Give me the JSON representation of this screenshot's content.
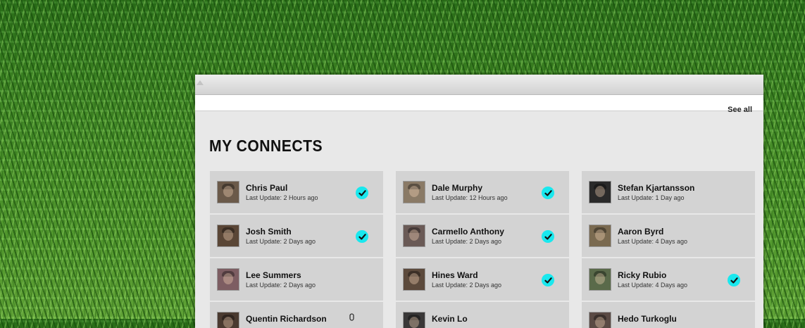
{
  "page": {
    "see_all": "See all",
    "section_title": "MY CONNECTS"
  },
  "connects": [
    {
      "name": "Chris Paul",
      "update": "Last Update: 2 Hours ago",
      "checked": true,
      "avatar_color": "#6b5a4a"
    },
    {
      "name": "Josh Smith",
      "update": "Last Update: 2 Days ago",
      "checked": true,
      "avatar_color": "#5a4636"
    },
    {
      "name": "Lee Summers",
      "update": "Last Update: 2 Days ago",
      "checked": false,
      "avatar_color": "#7d5d62"
    },
    {
      "name": "Quentin Richardson",
      "update": "",
      "checked": false,
      "avatar_color": "#4a3a30"
    },
    {
      "name": "Dale Murphy",
      "update": "Last Update: 12 Hours ago",
      "checked": true,
      "avatar_color": "#8a7a66"
    },
    {
      "name": "Carmello Anthony",
      "update": "Last Update: 2 Days ago",
      "checked": true,
      "avatar_color": "#6a5a56"
    },
    {
      "name": "Hines Ward",
      "update": "Last Update: 2 Days ago",
      "checked": true,
      "avatar_color": "#5c4a3c"
    },
    {
      "name": "Kevin Lo",
      "update": "",
      "checked": false,
      "avatar_color": "#3a3838"
    },
    {
      "name": "Stefan Kjartansson",
      "update": "Last Update: 1 Day ago",
      "checked": false,
      "avatar_color": "#2a2a2a"
    },
    {
      "name": "Aaron Byrd",
      "update": "Last Update: 4 Days ago",
      "checked": false,
      "avatar_color": "#7a6a50"
    },
    {
      "name": "Ricky Rubio",
      "update": "Last Update: 4 Days ago",
      "checked": true,
      "avatar_color": "#5a6a4a"
    },
    {
      "name": "Hedo Turkoglu",
      "update": "",
      "checked": false,
      "avatar_color": "#5a4a44"
    }
  ],
  "icons": {
    "check": "check-icon",
    "partial": "microphone-icon"
  },
  "colors": {
    "check_bg": "#19e8ee",
    "card_bg": "#d3d3d3",
    "panel_bg": "#e8e8e8"
  }
}
